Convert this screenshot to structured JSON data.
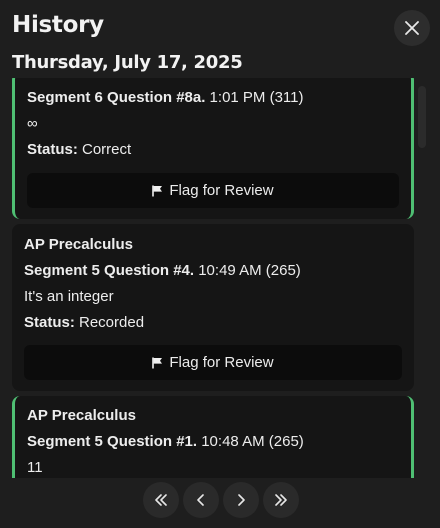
{
  "header": {
    "title": "History",
    "date": "Thursday, July 17, 2025"
  },
  "cards": [
    {
      "question_label": "Segment 6 Question #8a.",
      "meta": " 1:01 PM (311)",
      "answer": "∞",
      "status_label": "Status:",
      "status": " Correct",
      "flag_label": "Flag for Review"
    },
    {
      "course": "AP Precalculus",
      "question_label": "Segment 5 Question #4.",
      "meta": " 10:49 AM (265)",
      "answer": "It's an integer",
      "status_label": "Status:",
      "status": " Recorded",
      "flag_label": "Flag for Review"
    },
    {
      "course": "AP Precalculus",
      "question_label": "Segment 5 Question #1.",
      "meta": " 10:48 AM (265)",
      "answer": "11"
    }
  ],
  "colors": {
    "correct": "#4fbf73"
  },
  "icons": {
    "close": "close-icon",
    "flag": "flag-icon",
    "first": "double-chevron-left-icon",
    "prev": "chevron-left-icon",
    "next": "chevron-right-icon",
    "last": "double-chevron-right-icon"
  }
}
